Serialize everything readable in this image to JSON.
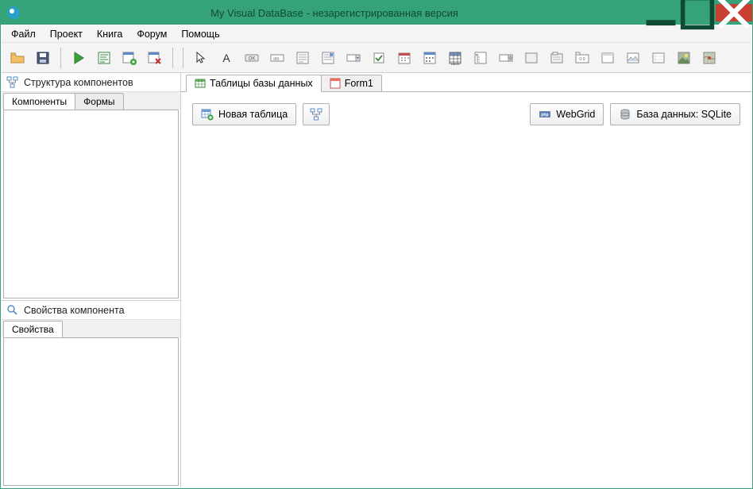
{
  "window": {
    "title": "My Visual DataBase - незарегистрированная версия"
  },
  "menu": {
    "file": "Файл",
    "project": "Проект",
    "book": "Книга",
    "forum": "Форум",
    "help": "Помощь"
  },
  "left": {
    "structure_title": "Структура компонентов",
    "tabs": {
      "components": "Компоненты",
      "forms": "Формы"
    },
    "props_title": "Свойства компонента",
    "props_tab": "Свойства"
  },
  "main": {
    "tabs": {
      "tables": "Таблицы базы данных",
      "form1": "Form1"
    },
    "buttons": {
      "new_table": "Новая таблица",
      "webgrid": "WebGrid",
      "database": "База данных: SQLite"
    }
  }
}
